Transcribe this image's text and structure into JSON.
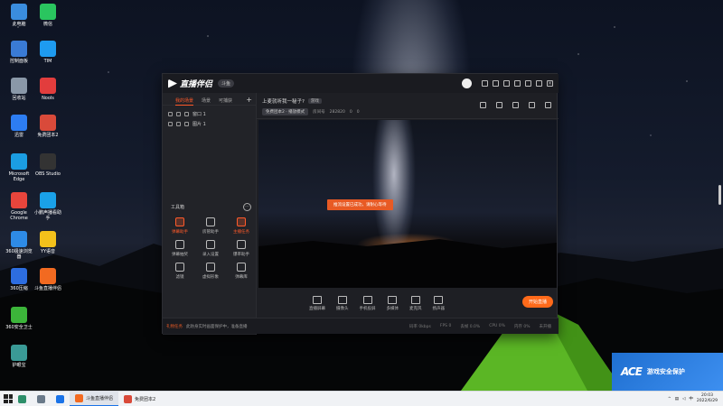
{
  "desktop_icons": [
    {
      "label": "此电脑",
      "icon": "computer-icon",
      "color": "#3a8dde"
    },
    {
      "label": "微信",
      "icon": "wechat-icon",
      "color": "#2ac55f"
    },
    {
      "label": "控制面板",
      "icon": "control-panel-icon",
      "color": "#3a7bd5"
    },
    {
      "label": "TIM",
      "icon": "tim-icon",
      "color": "#1e9bf0"
    },
    {
      "label": "回收站",
      "icon": "recycle-bin-icon",
      "color": "#8a98a8"
    },
    {
      "label": "Nools",
      "icon": "nools-icon",
      "color": "#e23d3d"
    },
    {
      "label": "迅雷",
      "icon": "xunlei-icon",
      "color": "#2d7df2"
    },
    {
      "label": "免费团本2",
      "icon": "game-icon",
      "color": "#d94a3a"
    },
    {
      "label": "Microsoft Edge",
      "icon": "edge-icon",
      "color": "#1b9de2"
    },
    {
      "label": "OBS Studio",
      "icon": "obs-icon",
      "color": "#333333"
    },
    {
      "label": "Google Chrome",
      "icon": "chrome-icon",
      "color": "#e8453c"
    },
    {
      "label": "小鹏声播看助手",
      "icon": "assistant-icon",
      "color": "#1aa1e8"
    },
    {
      "label": "360极速浏览器",
      "icon": "360-browser-icon",
      "color": "#2e8be6"
    },
    {
      "label": "YY语音",
      "icon": "yy-icon",
      "color": "#f3c11b"
    },
    {
      "label": "360压缩",
      "icon": "360-zip-icon",
      "color": "#2d6de0"
    },
    {
      "label": "斗鱼直播伴侣",
      "icon": "douyu-icon",
      "color": "#f26a21"
    },
    {
      "label": "360安全卫士",
      "icon": "360-security-icon",
      "color": "#3cb53a"
    },
    {
      "label": "护眼宝",
      "icon": "eye-care-icon",
      "color": "#3a9a96"
    }
  ],
  "app": {
    "logo_text": "直播伴侣",
    "badge": "斗鱼",
    "side_tabs": [
      "我的场景",
      "场景",
      "可捕获"
    ],
    "add": "+",
    "sources": [
      "窗口 1",
      "图片 1"
    ],
    "tools_title": "工具箱",
    "tools_more": "···",
    "tools": [
      {
        "label": "弹幕助手",
        "hl": true
      },
      {
        "label": "房管助手",
        "hl": false
      },
      {
        "label": "主播任务",
        "hl": true
      },
      {
        "label": "弹幕抽奖",
        "hl": false
      },
      {
        "label": "录入设置",
        "hl": false
      },
      {
        "label": "爆率助手",
        "hl": false
      },
      {
        "label": "滤镜",
        "hl": false
      },
      {
        "label": "虚拟形象",
        "hl": false
      },
      {
        "label": "弹幕库",
        "hl": false
      }
    ],
    "stream_title": "上麦就听我一秘子?",
    "stream_tag": "游戏",
    "category": "免费团本2 · 播放模式",
    "room_label": "房间号",
    "room_id": "282820",
    "likes": "0",
    "viewers": "0",
    "toast": "推流设置已成功，请耐心等待",
    "bottom_buttons": [
      "直播屏幕",
      "摄像头",
      "手机投屏",
      "多媒体",
      "麦克风",
      "扬声器"
    ],
    "start_button": "开始直播",
    "status_warn": "礼物任务",
    "status_text": "此防身实时画面保护中，准备直播",
    "stats": [
      "码率 0kbps",
      "FPS 0",
      "丢帧 0.0%",
      "CPU 0%",
      "内存 0%",
      "未开播"
    ]
  },
  "taskbar": {
    "apps": [
      {
        "label": "斗鱼直播伴侣",
        "color": "#f26a21",
        "active": true
      },
      {
        "label": "免费团本2",
        "color": "#d94a3a",
        "active": false
      }
    ],
    "ime": "中",
    "time": "20:03",
    "date": "2022/6/29"
  },
  "ad": {
    "logo": "ACE",
    "text": "游戏安全保护"
  }
}
